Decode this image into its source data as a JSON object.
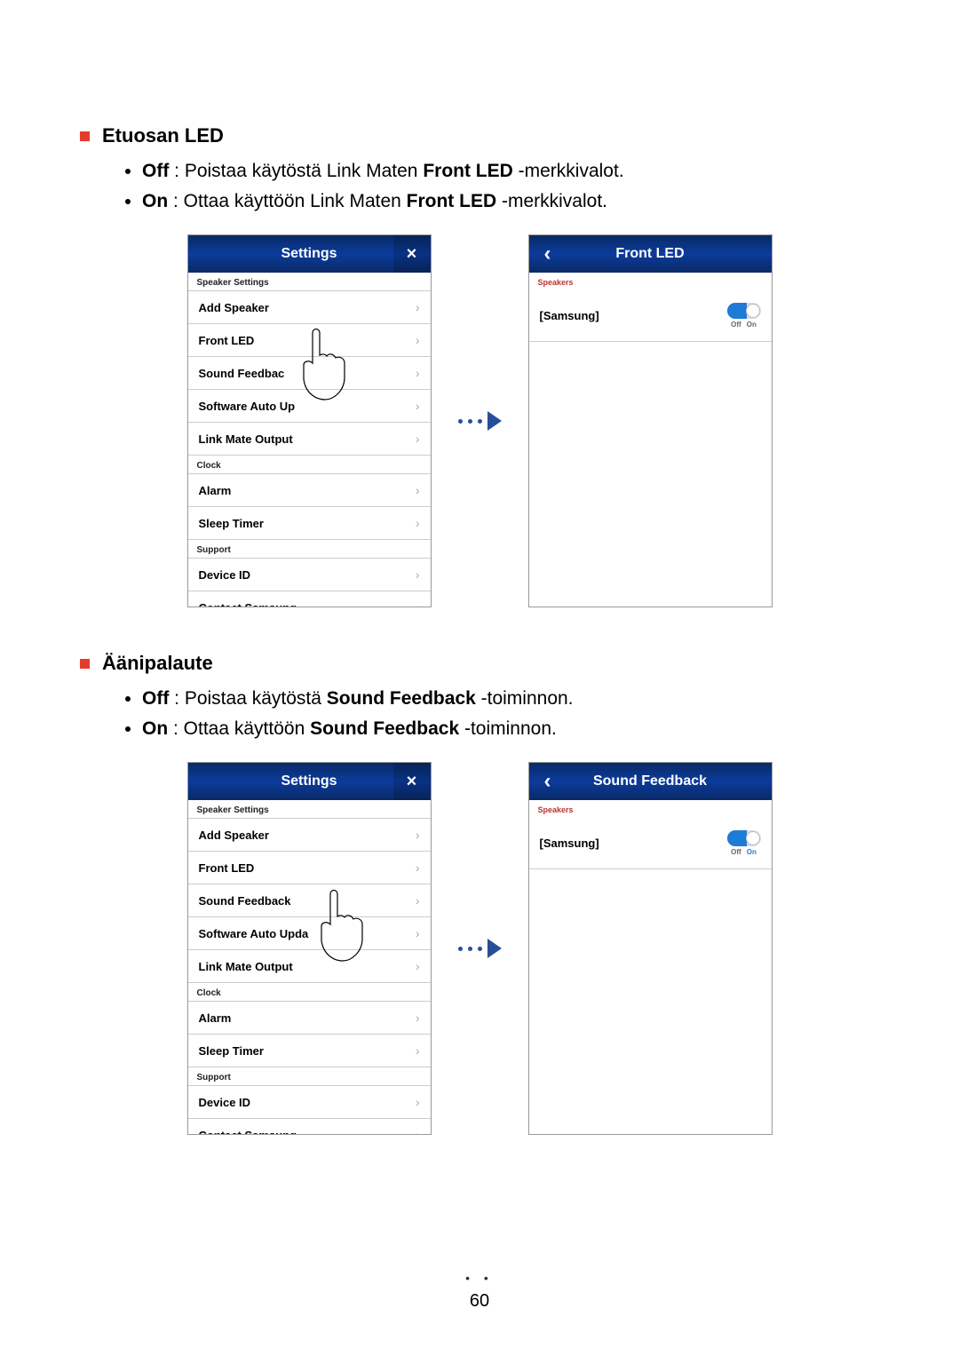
{
  "section1": {
    "title": "Etuosan LED",
    "off_label": "Off",
    "off_text_before": " : Poistaa käytöstä Link Maten ",
    "off_bold": "Front LED",
    "off_text_after": " -merkkivalot.",
    "on_label": "On",
    "on_text_before": " : Ottaa käyttöön Link Maten ",
    "on_bold": "Front LED",
    "on_text_after": " -merkkivalot."
  },
  "section2": {
    "title": "Äänipalaute",
    "off_label": "Off",
    "off_text_before": " : Poistaa käytöstä ",
    "off_bold": "Sound Feedback",
    "off_text_after": " -toiminnon.",
    "on_label": "On",
    "on_text_before": " : Ottaa käyttöön ",
    "on_bold": "Sound Feedback",
    "on_text_after": " -toiminnon."
  },
  "settingsPanel": {
    "title": "Settings",
    "groups": {
      "speaker": "Speaker Settings",
      "clock": "Clock",
      "support": "Support"
    },
    "items": {
      "add_speaker": "Add Speaker",
      "front_led": "Front LED",
      "sound_feedback_trunc": "Sound Feedbac",
      "sound_feedback": "Sound Feedback",
      "software_auto_up_trunc": "Software Auto Up",
      "software_auto_update": "Software Auto Upda",
      "link_mate_output": "Link Mate Output",
      "alarm": "Alarm",
      "sleep_timer": "Sleep Timer",
      "device_id": "Device ID",
      "contact_samsung": "Contact Samsung"
    }
  },
  "detail1": {
    "title": "Front LED",
    "group": "Speakers",
    "item": "[Samsung]",
    "off": "Off",
    "on": "On"
  },
  "detail2": {
    "title": "Sound Feedback",
    "group": "Speakers",
    "item": "[Samsung]",
    "off": "Off",
    "on": "On"
  },
  "page": "60"
}
